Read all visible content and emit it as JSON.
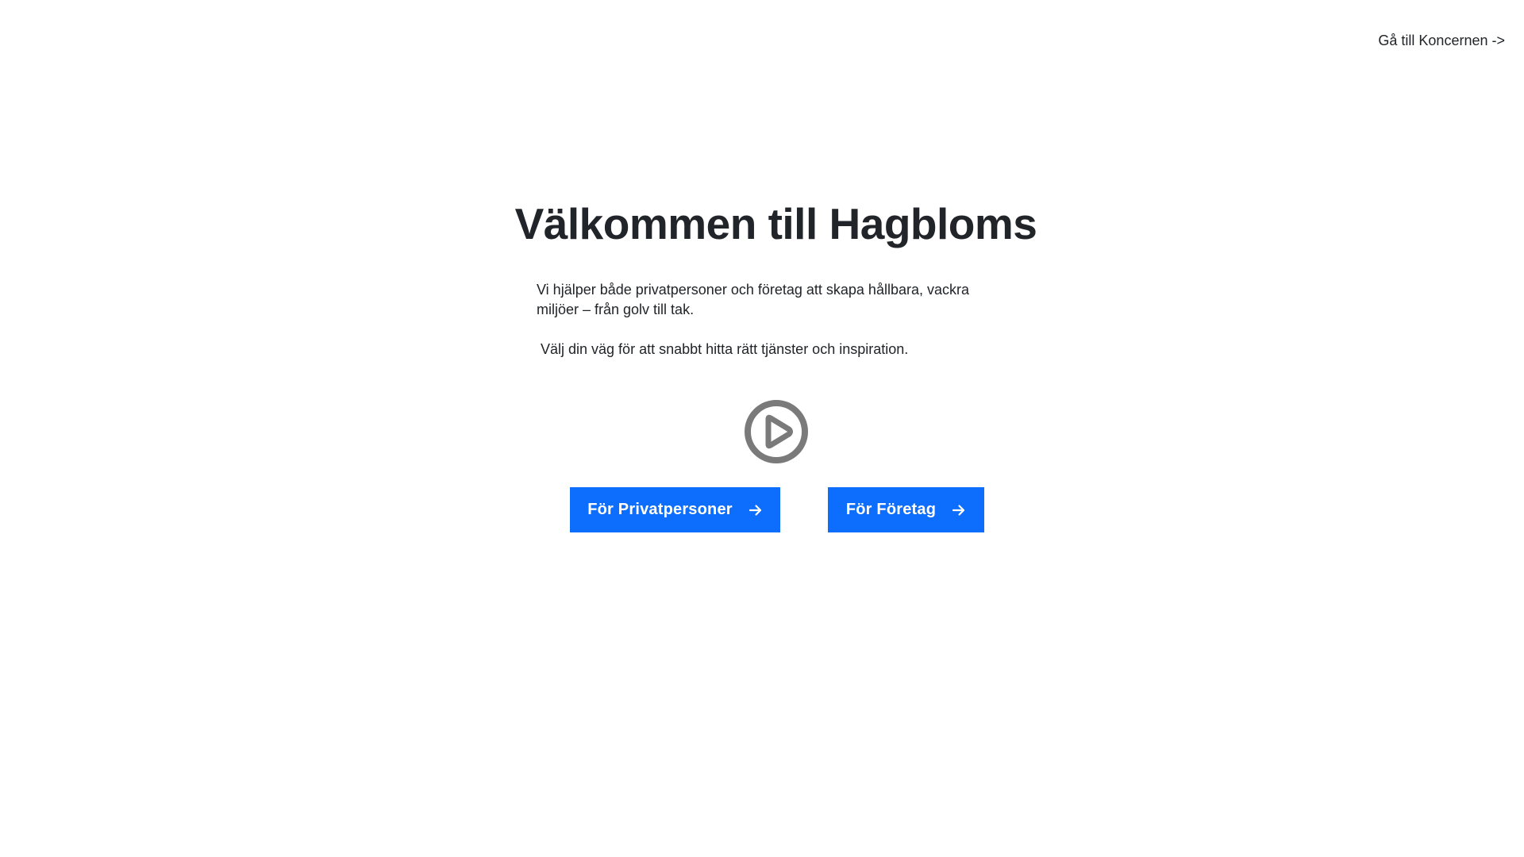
{
  "header": {
    "group_link": "Gå till Koncernen ->"
  },
  "hero": {
    "title": "Välkommen till Hagbloms",
    "paragraph_1": "Vi hjälper både privatpersoner och företag att skapa hållbara, vackra miljöer – från golv till tak.",
    "paragraph_2": "Välj din väg för att snabbt hitta rätt tjänster och inspiration."
  },
  "media": {
    "play_icon": "play-circle-icon",
    "icon_color": "#7a7a7a"
  },
  "buttons": {
    "private_label": "För Privatpersoner",
    "business_label": "För Företag",
    "arrow_icon": "arrow-right-icon",
    "color": "#0d6efd"
  }
}
